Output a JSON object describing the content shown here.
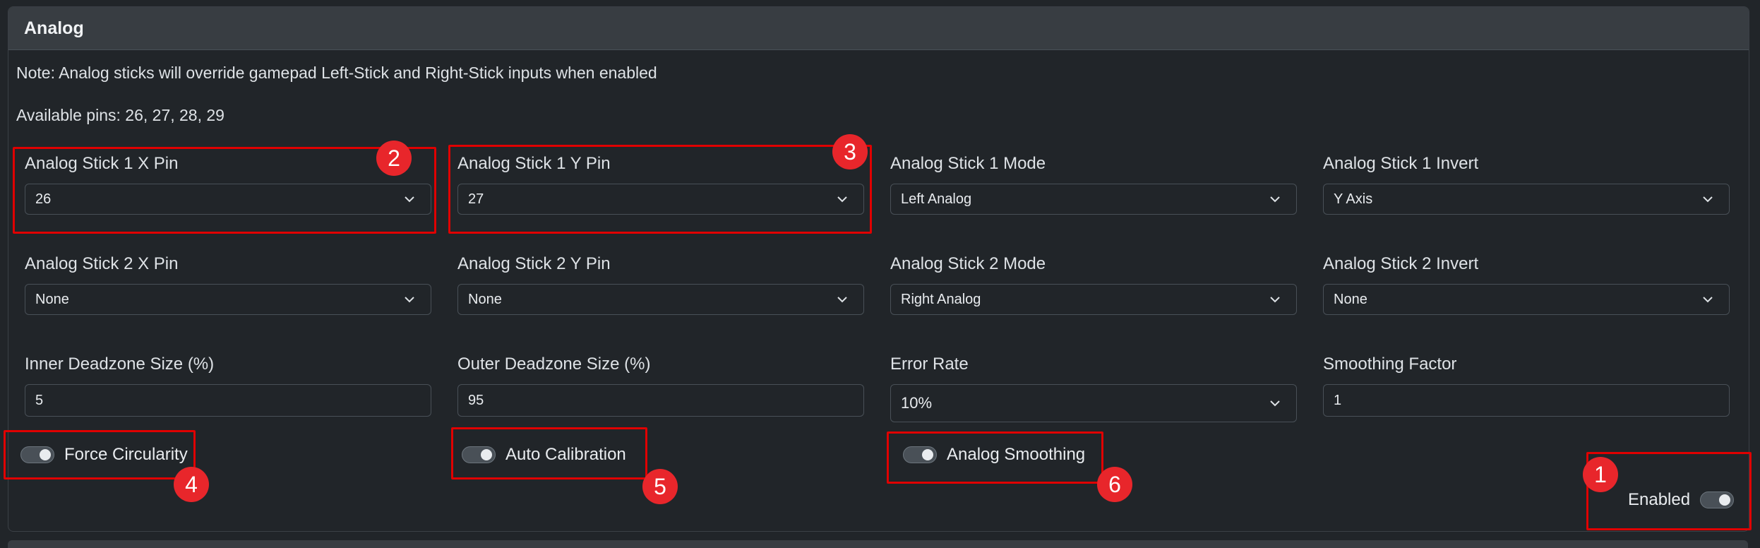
{
  "card": {
    "title": "Analog",
    "note": "Note: Analog sticks will override gamepad Left-Stick and Right-Stick inputs when enabled",
    "available_pins": "Available pins: 26, 27, 28, 29"
  },
  "fields": {
    "stick1_x_pin": {
      "label": "Analog Stick 1 X Pin",
      "value": "26"
    },
    "stick1_y_pin": {
      "label": "Analog Stick 1 Y Pin",
      "value": "27"
    },
    "stick1_mode": {
      "label": "Analog Stick 1 Mode",
      "value": "Left Analog"
    },
    "stick1_invert": {
      "label": "Analog Stick 1 Invert",
      "value": "Y Axis"
    },
    "stick2_x_pin": {
      "label": "Analog Stick 2 X Pin",
      "value": "None"
    },
    "stick2_y_pin": {
      "label": "Analog Stick 2 Y Pin",
      "value": "None"
    },
    "stick2_mode": {
      "label": "Analog Stick 2 Mode",
      "value": "Right Analog"
    },
    "stick2_invert": {
      "label": "Analog Stick 2 Invert",
      "value": "None"
    },
    "inner_deadzone": {
      "label": "Inner Deadzone Size (%)",
      "value": "5"
    },
    "outer_deadzone": {
      "label": "Outer Deadzone Size (%)",
      "value": "95"
    },
    "error_rate": {
      "label": "Error Rate",
      "value": "10%"
    },
    "smoothing_factor": {
      "label": "Smoothing Factor",
      "value": "1"
    }
  },
  "toggles": {
    "force_circularity": "Force Circularity",
    "auto_calibration": "Auto Calibration",
    "analog_smoothing": "Analog Smoothing",
    "enabled": "Enabled"
  },
  "annotations": [
    "1",
    "2",
    "3",
    "4",
    "5",
    "6"
  ],
  "colors": {
    "background": "#212529",
    "header": "#383d42",
    "highlight": "#e00000",
    "badge": "#e8262b"
  }
}
